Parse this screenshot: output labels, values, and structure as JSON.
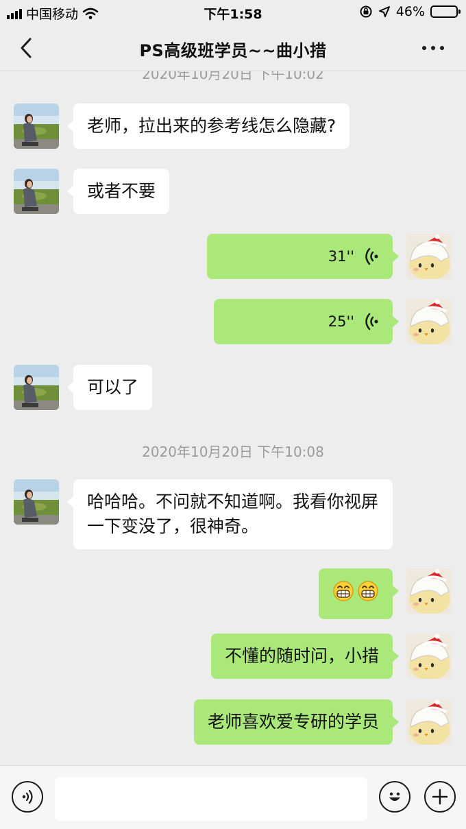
{
  "status_bar": {
    "carrier": "中国移动",
    "time": "下午1:58",
    "battery": "46%",
    "battery_level": 0.46
  },
  "nav": {
    "title": "PS高级班学员~~曲小措"
  },
  "messages": [
    {
      "type": "timestamp",
      "text": "2020年10月20日 下午10:02"
    },
    {
      "type": "text",
      "side": "left",
      "text": "老师，拉出来的参考线怎么隐藏?"
    },
    {
      "type": "text",
      "side": "left",
      "text": "或者不要"
    },
    {
      "type": "voice",
      "side": "right",
      "duration": "31''"
    },
    {
      "type": "voice",
      "side": "right",
      "duration": "25''"
    },
    {
      "type": "text",
      "side": "left",
      "text": "可以了"
    },
    {
      "type": "timestamp",
      "text": "2020年10月20日 下午10:08"
    },
    {
      "type": "text",
      "side": "left",
      "text": "哈哈哈。不问就不知道啊。我看你视屏一下变没了，很神奇。"
    },
    {
      "type": "emoji",
      "side": "right",
      "icons": [
        "grin-icon",
        "grin-icon"
      ]
    },
    {
      "type": "text",
      "side": "right",
      "text": "不懂的随时问，小措"
    },
    {
      "type": "text",
      "side": "right",
      "text": "老师喜欢爱专研的学员"
    }
  ],
  "input": {
    "value": "",
    "placeholder": ""
  },
  "icons": {
    "back": "chevron-left-icon",
    "more": "more-icon",
    "voice_mode": "voice-mode-icon",
    "emoji": "emoji-icon",
    "plus": "plus-icon"
  },
  "colors": {
    "background": "#ededed",
    "sent_bubble": "#a9e879",
    "received_bubble": "#ffffff",
    "timestamp": "#9b9b9b"
  }
}
